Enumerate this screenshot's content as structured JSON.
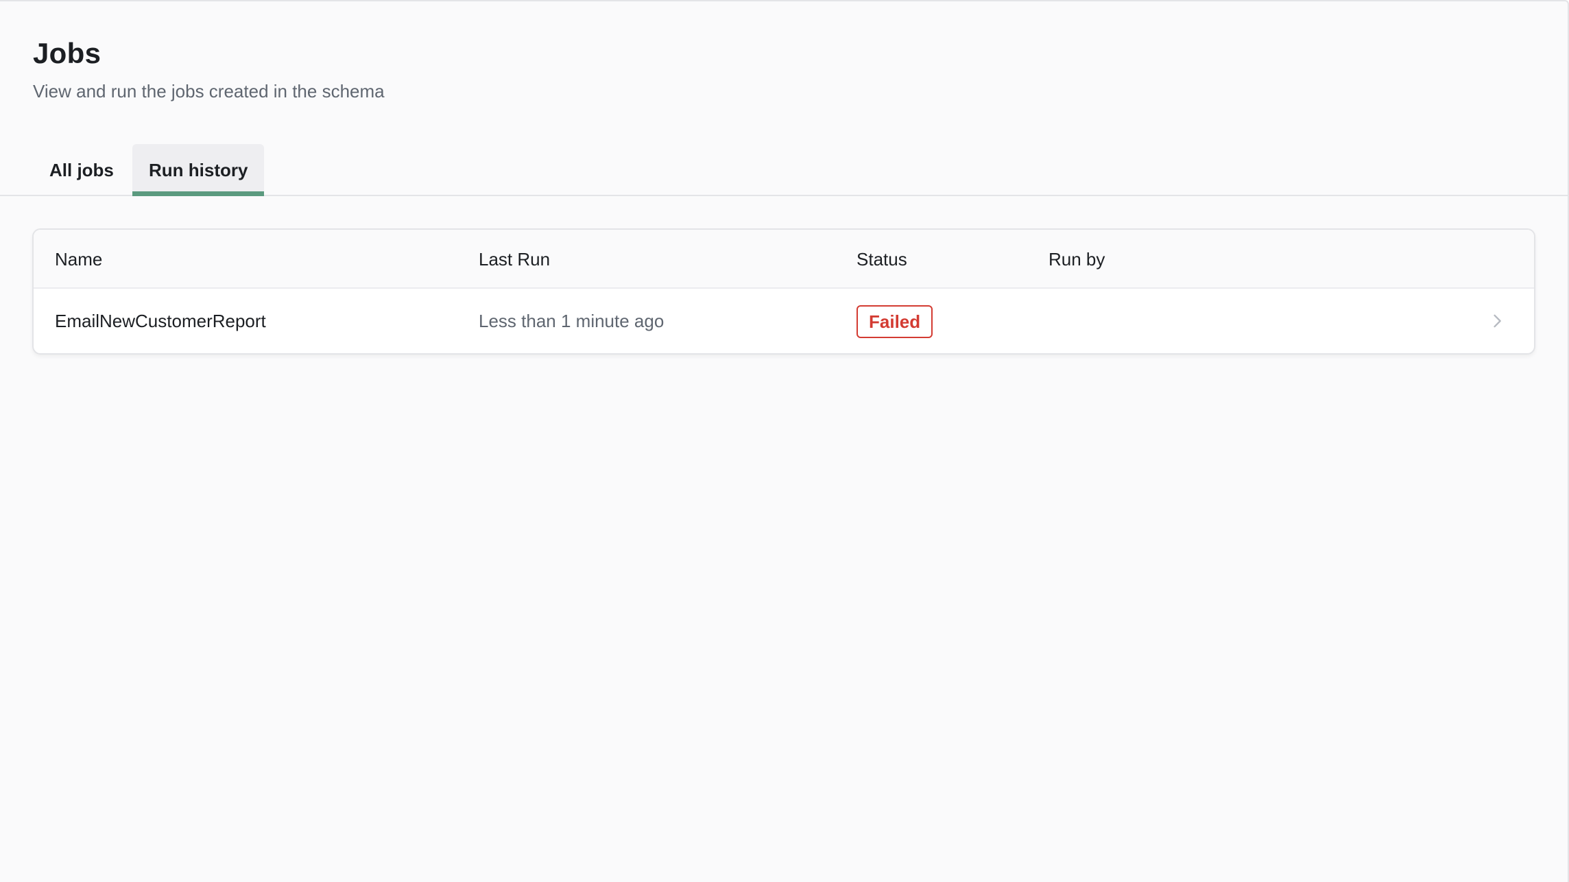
{
  "header": {
    "title": "Jobs",
    "subtitle": "View and run the jobs created in the schema"
  },
  "tabs": [
    {
      "label": "All jobs",
      "active": false
    },
    {
      "label": "Run history",
      "active": true
    }
  ],
  "table": {
    "columns": [
      "Name",
      "Last Run",
      "Status",
      "Run by"
    ],
    "rows": [
      {
        "name": "EmailNewCustomerReport",
        "last_run": "Less than 1 minute ago",
        "status": "Failed",
        "run_by": ""
      }
    ]
  },
  "colors": {
    "active_tab_indicator": "#5b9a7f",
    "status_failed": "#d33b32"
  },
  "icons": {
    "row_action": "chevron-right-icon"
  }
}
